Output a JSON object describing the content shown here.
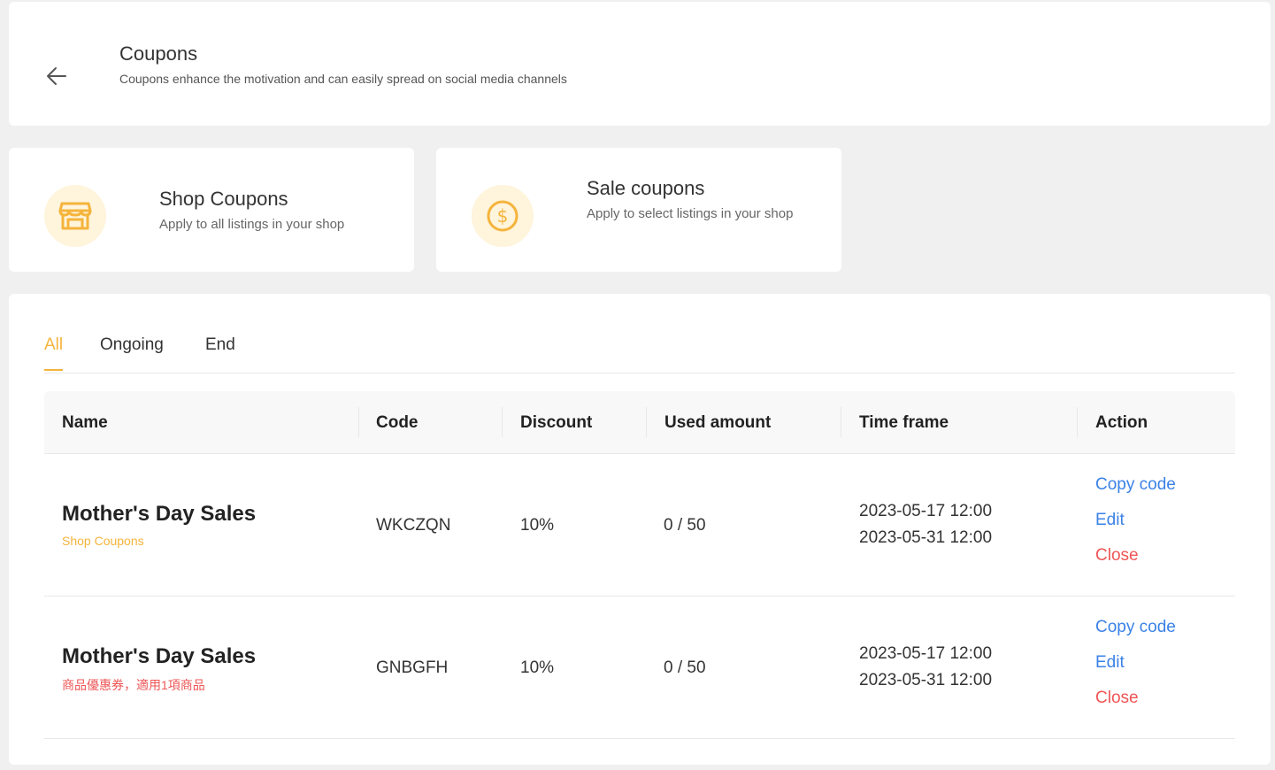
{
  "header": {
    "title": "Coupons",
    "subtitle": "Coupons enhance the motivation and can easily spread on social media channels"
  },
  "coupon_types": {
    "shop": {
      "title": "Shop Coupons",
      "description": "Apply to all listings in your shop",
      "icon": "store-icon"
    },
    "sale": {
      "title": "Sale coupons",
      "description": "Apply to select listings in your shop",
      "icon": "dollar-coin-icon"
    }
  },
  "tabs": [
    {
      "label": "All",
      "active": true
    },
    {
      "label": "Ongoing",
      "active": false
    },
    {
      "label": "End",
      "active": false
    }
  ],
  "table": {
    "columns": [
      "Name",
      "Code",
      "Discount",
      "Used amount",
      "Time frame",
      "Action"
    ],
    "rows": [
      {
        "name": "Mother's Day Sales",
        "tag": "Shop Coupons",
        "tag_color": "#f5b43c",
        "code": "WKCZQN",
        "discount": "10%",
        "used": "0 / 50",
        "start": "2023-05-17 12:00",
        "end": "2023-05-31 12:00",
        "actions": {
          "copy": "Copy code",
          "edit": "Edit",
          "close": "Close"
        }
      },
      {
        "name": "Mother's Day Sales",
        "tag": "商品優惠券，適用1項商品",
        "tag_color": "#ee5555",
        "code": "GNBGFH",
        "discount": "10%",
        "used": "0 / 50",
        "start": "2023-05-17 12:00",
        "end": "2023-05-31 12:00",
        "actions": {
          "copy": "Copy code",
          "edit": "Edit",
          "close": "Close"
        }
      }
    ]
  },
  "colors": {
    "accent": "#f5b43c",
    "link": "#3b82e6",
    "danger": "#ee5555",
    "background": "#f0f0f0"
  }
}
